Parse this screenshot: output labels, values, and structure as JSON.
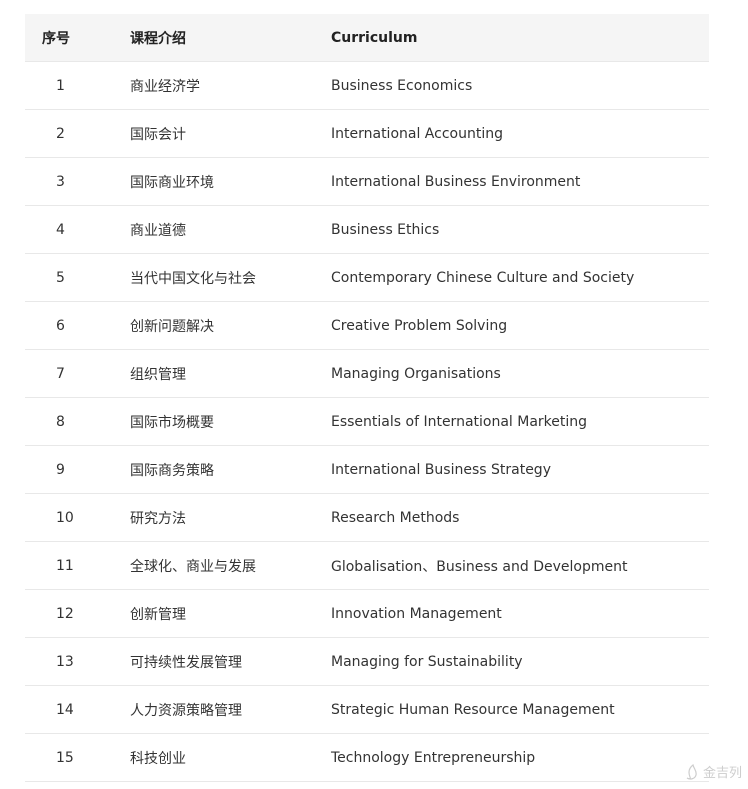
{
  "table": {
    "headers": {
      "no": "序号",
      "cn": "课程介绍",
      "en": "Curriculum"
    },
    "rows": [
      {
        "no": "1",
        "cn": "商业经济学",
        "en": "Business Economics"
      },
      {
        "no": "2",
        "cn": "国际会计",
        "en": "International Accounting"
      },
      {
        "no": "3",
        "cn": "国际商业环境",
        "en": "International Business Environment"
      },
      {
        "no": "4",
        "cn": "商业道德",
        "en": "Business Ethics"
      },
      {
        "no": "5",
        "cn": "当代中国文化与社会",
        "en": "Contemporary Chinese Culture and Society"
      },
      {
        "no": "6",
        "cn": "创新问题解决",
        "en": "Creative Problem Solving"
      },
      {
        "no": "7",
        "cn": "组织管理",
        "en": "Managing Organisations"
      },
      {
        "no": "8",
        "cn": "国际市场概要",
        "en": "Essentials of International Marketing"
      },
      {
        "no": "9",
        "cn": "国际商务策略",
        "en": "International Business Strategy"
      },
      {
        "no": "10",
        "cn": "研究方法",
        "en": "Research Methods"
      },
      {
        "no": "11",
        "cn": "全球化、商业与发展",
        "en": "Globalisation、Business and Development"
      },
      {
        "no": "12",
        "cn": "创新管理",
        "en": "Innovation Management"
      },
      {
        "no": "13",
        "cn": "可持续性发展管理",
        "en": "Managing for Sustainability"
      },
      {
        "no": "14",
        "cn": "人力资源策略管理",
        "en": "Strategic Human Resource Management"
      },
      {
        "no": "15",
        "cn": "科技创业",
        "en": "Technology Entrepreneurship"
      }
    ]
  },
  "watermark": {
    "text": "金吉列"
  }
}
